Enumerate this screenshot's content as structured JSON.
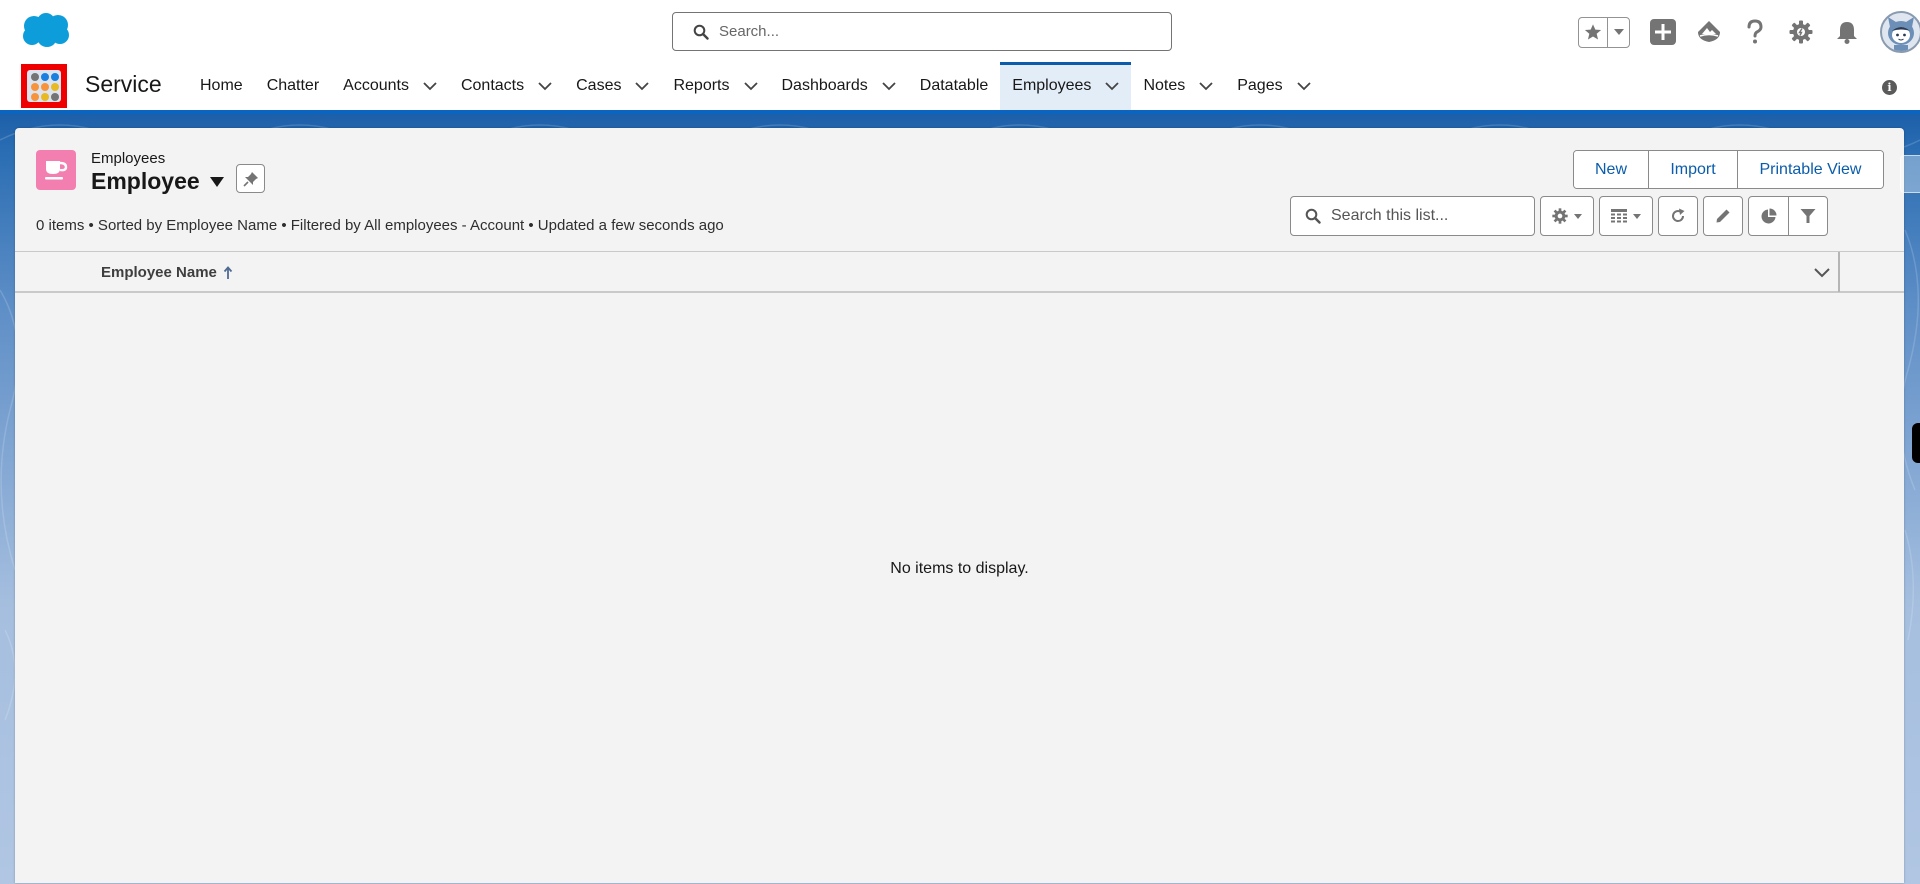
{
  "global_header": {
    "search": {
      "placeholder": "Search..."
    },
    "icons": [
      "salesforce-cloud-logo",
      "favorites-star-icon",
      "favorites-dropdown-icon",
      "global-actions-plus-icon",
      "trailhead-icon",
      "help-icon",
      "setup-gear-icon",
      "notifications-bell-icon",
      "user-avatar"
    ]
  },
  "nav": {
    "app_name": "Service",
    "items": [
      {
        "label": "Home",
        "has_menu": false,
        "active": false
      },
      {
        "label": "Chatter",
        "has_menu": false,
        "active": false
      },
      {
        "label": "Accounts",
        "has_menu": true,
        "active": false
      },
      {
        "label": "Contacts",
        "has_menu": true,
        "active": false
      },
      {
        "label": "Cases",
        "has_menu": true,
        "active": false
      },
      {
        "label": "Reports",
        "has_menu": true,
        "active": false
      },
      {
        "label": "Dashboards",
        "has_menu": true,
        "active": false
      },
      {
        "label": "Datatable",
        "has_menu": false,
        "active": false
      },
      {
        "label": "Employees",
        "has_menu": true,
        "active": true
      },
      {
        "label": "Notes",
        "has_menu": true,
        "active": false
      },
      {
        "label": "Pages",
        "has_menu": true,
        "active": false
      }
    ],
    "info_icon": "i"
  },
  "list_view": {
    "object_label": "Employees",
    "title": "Employee",
    "meta": "0 items • Sorted by Employee Name • Filtered by All employees - Account • Updated a few seconds ago",
    "actions": {
      "new": "New",
      "import": "Import",
      "printable_view": "Printable View"
    },
    "search": {
      "placeholder": "Search this list..."
    },
    "toolbar_icons": [
      "list-view-controls-gear-icon",
      "display-as-table-icon",
      "refresh-icon",
      "edit-list-icon",
      "charts-icon",
      "filter-icon"
    ],
    "columns": [
      {
        "label": "Employee Name",
        "sort": "ascending"
      }
    ],
    "rows": [],
    "empty_message": "No items to display."
  },
  "colors": {
    "brand_blue": "#0b5cab",
    "active_tab_bg": "#e3edf8",
    "object_icon_pink": "#f37eb0",
    "launcher_highlight": "#ee0000"
  }
}
